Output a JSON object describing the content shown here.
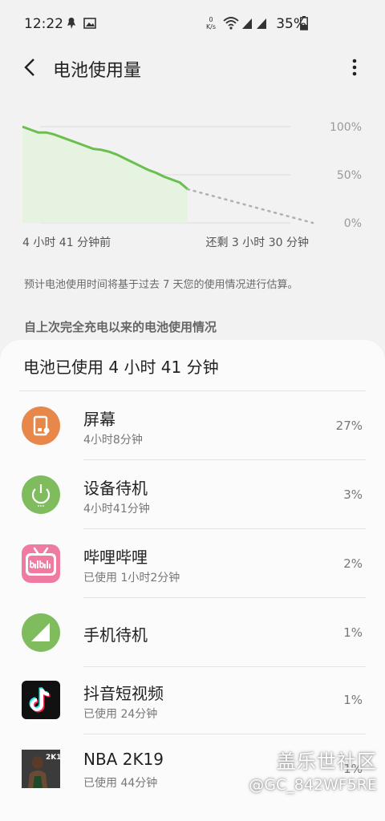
{
  "status_bar": {
    "time": "12:22",
    "battery_percent": "35%",
    "net_speed": "0 K/s"
  },
  "app_bar": {
    "title": "电池使用量"
  },
  "chart_data": {
    "type": "area",
    "title": "",
    "ylabel": "",
    "y_ticks": [
      "100%",
      "50%",
      "0%"
    ],
    "ylim": [
      0,
      100
    ],
    "x_start_label": "4 小时 41 分钟前",
    "x_end_label": "还剩 3 小时 30 分钟",
    "series": [
      {
        "values": [
          100,
          97,
          94,
          94,
          92,
          89,
          86,
          83,
          80,
          77,
          76,
          74,
          71,
          67,
          63,
          59,
          55,
          52,
          48,
          45,
          42,
          35
        ]
      },
      {
        "values": [
          35,
          0
        ],
        "style": "dashed"
      }
    ],
    "colors": {
      "line": "#6bbf4e",
      "fill": "#e6f3e1",
      "projection": "#b0b0b0",
      "grid": "#dcdcdc"
    }
  },
  "estimate_note": "预计电池使用时间将基于过去 7 天您的使用情况进行估算。",
  "section_header": "自上次完全充电以来的电池使用情况",
  "usage_card": {
    "title": "电池已使用 4 小时 41 分钟",
    "items": [
      {
        "name": "屏幕",
        "detail": "4小时8分钟",
        "percent": "27%",
        "icon": "screen-icon",
        "color": "#e8874a"
      },
      {
        "name": "设备待机",
        "detail": "4小时41分钟",
        "percent": "3%",
        "icon": "power-icon",
        "color": "#7fbc5e"
      },
      {
        "name": "哔哩哔哩",
        "detail": "已使用 1小时2分钟",
        "percent": "2%",
        "icon": "bilibili-app-icon",
        "color": "#f07ba0"
      },
      {
        "name": "手机待机",
        "detail": "",
        "percent": "1%",
        "icon": "cell-signal-icon",
        "color": "#7fbc5e"
      },
      {
        "name": "抖音短视频",
        "detail": "已使用 24分钟",
        "percent": "1%",
        "icon": "douyin-app-icon",
        "color": "#111111"
      },
      {
        "name": "NBA 2K19",
        "detail": "已使用 44分钟",
        "percent": "1%",
        "icon": "nba2k19-app-icon",
        "color": "#333333"
      }
    ]
  },
  "watermark": {
    "line1": "盖乐世社区",
    "line2": "@GC_842WF5RE"
  }
}
